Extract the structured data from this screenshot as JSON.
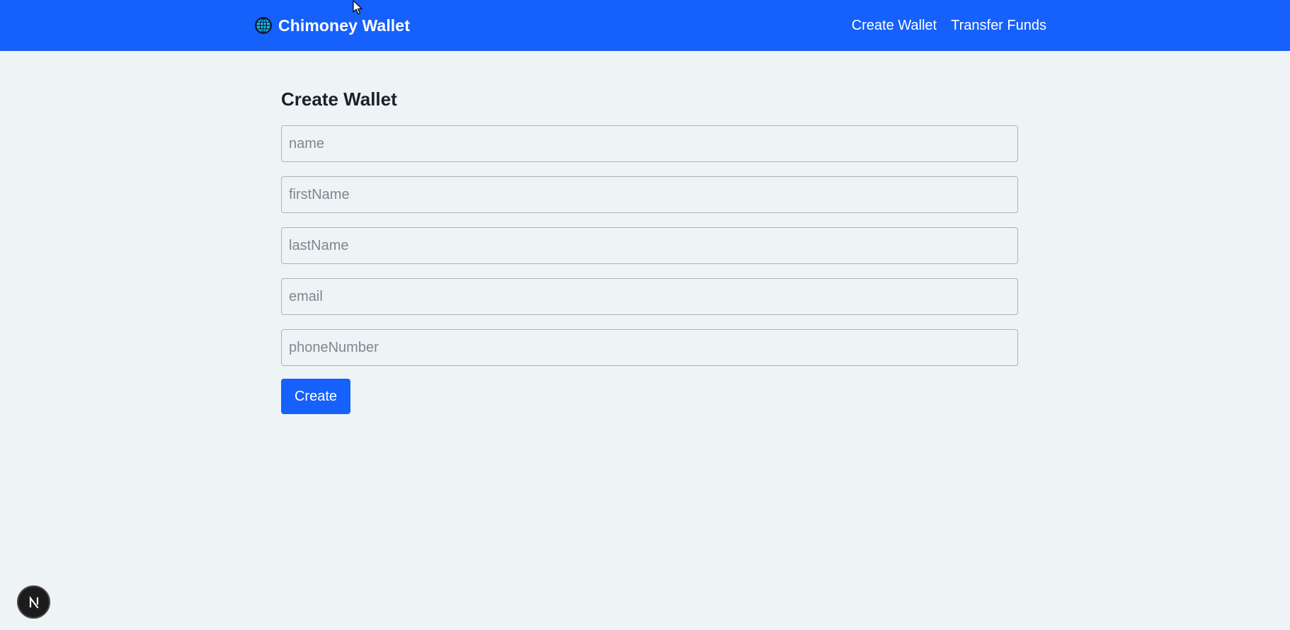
{
  "header": {
    "brand_name": "Chimoney Wallet",
    "brand_logo_icon": "globe-icon",
    "nav": [
      {
        "label": "Create Wallet"
      },
      {
        "label": "Transfer Funds"
      }
    ],
    "background_color": "#1660fb"
  },
  "form": {
    "title": "Create Wallet",
    "fields": [
      {
        "placeholder": "name",
        "value": ""
      },
      {
        "placeholder": "firstName",
        "value": ""
      },
      {
        "placeholder": "lastName",
        "value": ""
      },
      {
        "placeholder": "email",
        "value": ""
      },
      {
        "placeholder": "phoneNumber",
        "value": ""
      }
    ],
    "submit_label": "Create"
  },
  "dev_badge": {
    "icon": "nextjs-logo-icon",
    "letter": "N"
  },
  "colors": {
    "accent": "#1660fb",
    "page_background": "#eef3f6"
  }
}
